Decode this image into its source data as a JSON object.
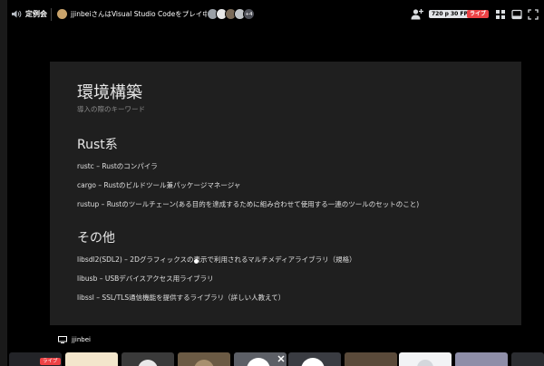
{
  "header": {
    "channel_name": "定例会",
    "stream_title": "jjinbeiさんはVisual Studio Codeをプレイ中です",
    "viewers_more": "+4",
    "quality": "720 p 30 FPS",
    "live_label": "ライブ"
  },
  "slide": {
    "title": "環境構築",
    "subtitle": "導入の際のキーワード",
    "sections": [
      {
        "heading": "Rust系",
        "items": [
          "rustc – Rustのコンパイラ",
          "cargo – Rustのビルドツール兼パッケージマネージャ",
          "rustup – Rustのツールチェーン(ある目的を達成するために組み合わせて使用する一連のツールのセットのこと)"
        ]
      },
      {
        "heading": "その他",
        "items": [
          "libsdl2(SDL2) – 2Dグラフィックスの表示で利用されるマルチメディアライブラリ（規格）",
          "libusb – USBデバイスアクセス用ライブラリ",
          "libssl – SSL/TLS通信機能を提供するライブラリ（詳しい人教えて）"
        ]
      }
    ]
  },
  "streamer": {
    "name": "jjinbei"
  },
  "participants": {
    "live_label": "ライブ"
  },
  "colors": {
    "slide_bg": "#1f1f1f",
    "live_red": "#ed4245",
    "quality_bg": "#e3e5e8"
  },
  "icons": [
    "speaker-icon",
    "add-friend-icon",
    "grid-layout-icon",
    "popout-icon",
    "fullscreen-icon",
    "screen-share-icon",
    "close-icon"
  ]
}
